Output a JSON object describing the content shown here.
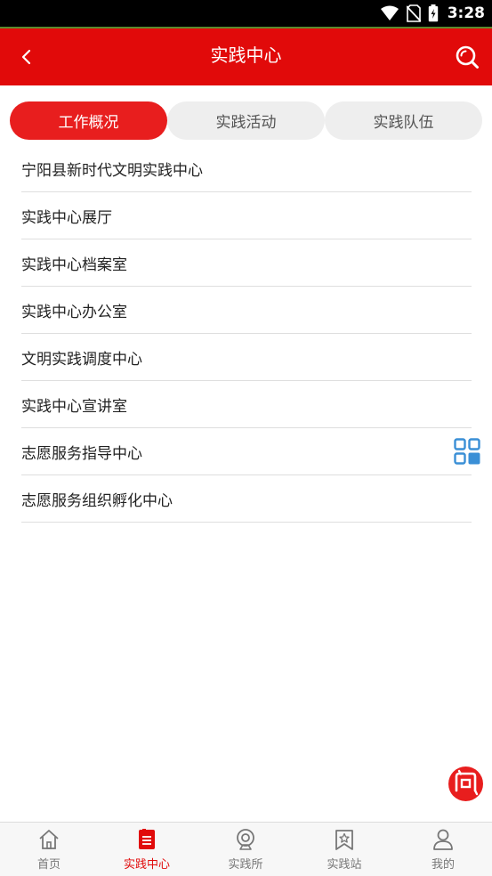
{
  "status_bar": {
    "time": "3:28"
  },
  "header": {
    "title": "实践中心"
  },
  "tabs": [
    {
      "label": "工作概况",
      "active": true
    },
    {
      "label": "实践活动",
      "active": false
    },
    {
      "label": "实践队伍",
      "active": false
    }
  ],
  "list": {
    "items": [
      "宁阳县新时代文明实践中心",
      "实践中心展厅",
      "实践中心档案室",
      "实践中心办公室",
      "文明实践调度中心",
      "实践中心宣讲室",
      "志愿服务指导中心",
      "志愿服务组织孵化中心"
    ]
  },
  "floating": {
    "ask_icon": "ask-icon",
    "grid_icon": "grid-icon"
  },
  "bottom_nav": {
    "items": [
      {
        "label": "首页",
        "icon": "home-icon",
        "active": false
      },
      {
        "label": "实践中心",
        "icon": "document-icon",
        "active": true
      },
      {
        "label": "实践所",
        "icon": "webcam-icon",
        "active": false
      },
      {
        "label": "实践站",
        "icon": "star-bookmark-icon",
        "active": false
      },
      {
        "label": "我的",
        "icon": "user-icon",
        "active": false
      }
    ]
  },
  "colors": {
    "brand_red": "#e10a0a",
    "tab_active": "#e81e1e",
    "tab_inactive": "#eeeeee",
    "accent_blue": "#3a8fd6"
  }
}
